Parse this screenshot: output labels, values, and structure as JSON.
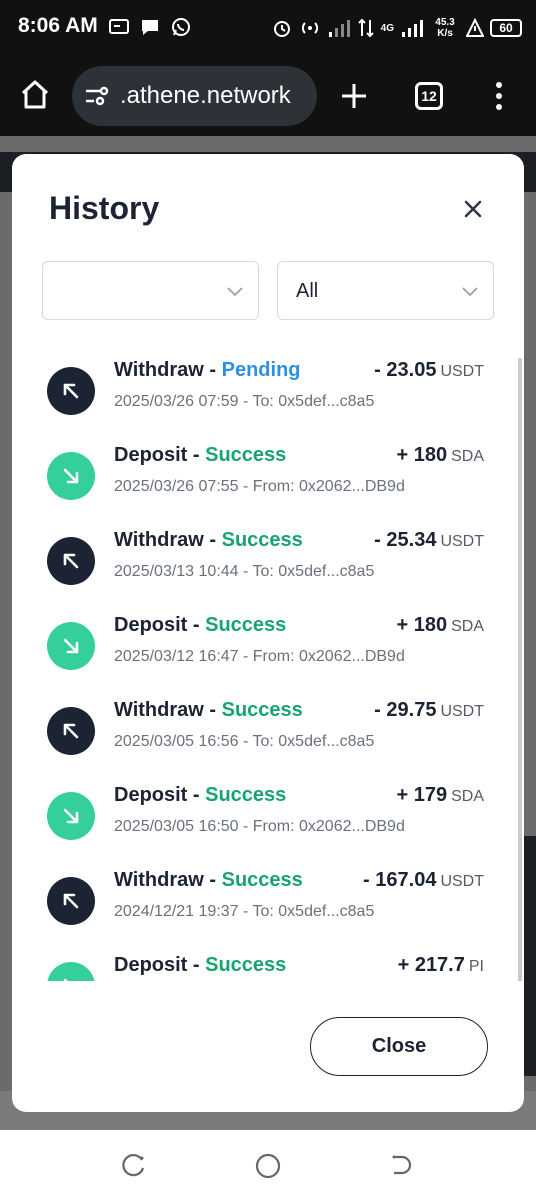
{
  "status_bar": {
    "time": "8:06 AM",
    "network_speed": "45.3 K/s",
    "network_type": "4G",
    "battery": "60"
  },
  "browser": {
    "url": ".athene.network",
    "tab_count": "12"
  },
  "modal": {
    "title": "History",
    "filter_1_value": "",
    "filter_2_value": "All",
    "close_button_label": "Close"
  },
  "transactions": [
    {
      "type": "Withdraw",
      "status": "Pending",
      "amount": "- 23.05",
      "unit": "USDT",
      "detail": "2025/03/26 07:59 - To: 0x5def...c8a5"
    },
    {
      "type": "Deposit",
      "status": "Success",
      "amount": "+ 180",
      "unit": "SDA",
      "detail": "2025/03/26 07:55 - From: 0x2062...DB9d"
    },
    {
      "type": "Withdraw",
      "status": "Success",
      "amount": "- 25.34",
      "unit": "USDT",
      "detail": "2025/03/13 10:44 - To: 0x5def...c8a5"
    },
    {
      "type": "Deposit",
      "status": "Success",
      "amount": "+ 180",
      "unit": "SDA",
      "detail": "2025/03/12 16:47 - From: 0x2062...DB9d"
    },
    {
      "type": "Withdraw",
      "status": "Success",
      "amount": "- 29.75",
      "unit": "USDT",
      "detail": "2025/03/05 16:56 - To: 0x5def...c8a5"
    },
    {
      "type": "Deposit",
      "status": "Success",
      "amount": "+ 179",
      "unit": "SDA",
      "detail": "2025/03/05 16:50 - From: 0x2062...DB9d"
    },
    {
      "type": "Withdraw",
      "status": "Success",
      "amount": "- 167.04",
      "unit": "USDT",
      "detail": "2024/12/21 19:37 - To: 0x5def...c8a5"
    },
    {
      "type": "Deposit",
      "status": "Success",
      "amount": "+ 217.7",
      "unit": "PI",
      "detail": ""
    }
  ],
  "colors": {
    "navy": "#1c2333",
    "success": "#18a46e",
    "pending": "#2e90e0",
    "deposit_avatar": "#34cf9a"
  }
}
